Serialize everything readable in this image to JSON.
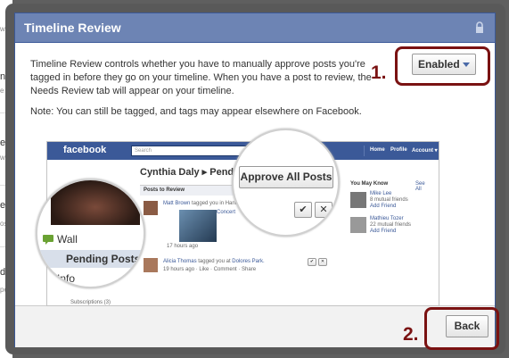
{
  "background_page": {
    "fragments": [
      "w",
      "ng",
      "e",
      "es",
      "w",
      "e f",
      "osts",
      "d A",
      "pe"
    ]
  },
  "dialog": {
    "title": "Timeline Review",
    "description": "Timeline Review controls whether you have to manually approve posts you're tagged in before they go on your timeline. When you have a post to review, the Needs Review tab will appear on your timeline.",
    "note": "Note: You can still be tagged, and tags may appear elsewhere on Facebook.",
    "setting_value": "Enabled",
    "step1_label": "1.",
    "step2_label": "2.",
    "back_label": "Back"
  },
  "screenshot": {
    "logo": "facebook",
    "search_placeholder": "Search",
    "nav": [
      "Home",
      "Profile",
      "Account ▾"
    ],
    "page_title": "Cynthia Daly ▸ Pending Posts",
    "section_header": "Posts to Review",
    "post1_author": "Matt Brown",
    "post1_text": "tagged you in Hannah",
    "post1_album": "Concert",
    "post1_time": "17 hours ago",
    "post2_author": "Alicia Thomas",
    "post2_text": "tagged you at",
    "post2_place": "Dolores Park.",
    "post2_meta": "19 hours ago · Like · Comment · Share",
    "you_may_know": "You May Know",
    "see_all": "See All",
    "friend1_name": "Mike Lee",
    "friend1_mutual": "8 mutual friends",
    "friend1_action": "Add Friend",
    "friend2_name": "Mathieu Tozer",
    "friend2_mutual": "22 mutual friends",
    "friend2_action": "Add Friend",
    "subscriptions": "Subscriptions (3)",
    "zoom_left": {
      "item1": "Wall",
      "item2": "Pending Posts",
      "item3": "Info"
    },
    "zoom_right": {
      "approve_label": "Approve All Posts",
      "check_glyph": "✔",
      "close_glyph": "✕"
    }
  },
  "colors": {
    "fb_blue": "#3b5998",
    "header_blue": "#6d84b4",
    "callout_red": "#7a1212"
  }
}
